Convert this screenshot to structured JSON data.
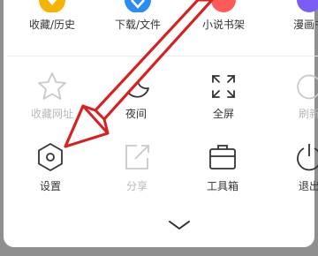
{
  "top_row": [
    {
      "label": "收藏/历史",
      "icon": "star-circle-icon",
      "color": "#f5b400"
    },
    {
      "label": "下载/文件",
      "icon": "download-circle-icon",
      "color": "#2a8cf4"
    },
    {
      "label": "小说书架",
      "icon": "book-circle-icon",
      "color": "#ff5a5a"
    },
    {
      "label": "漫画书",
      "icon": "comic-circle-icon",
      "color": "#7b5cf5"
    }
  ],
  "row1": [
    {
      "label": "收藏网址",
      "icon": "star-outline-icon",
      "enabled": false
    },
    {
      "label": "夜间",
      "icon": "moon-icon",
      "enabled": true
    },
    {
      "label": "全屏",
      "icon": "fullscreen-icon",
      "enabled": true
    },
    {
      "label": "刷新",
      "icon": "refresh-icon",
      "enabled": false
    }
  ],
  "row2": [
    {
      "label": "设置",
      "icon": "hexagon-settings-icon",
      "enabled": true
    },
    {
      "label": "分享",
      "icon": "share-icon",
      "enabled": false
    },
    {
      "label": "工具箱",
      "icon": "toolbox-icon",
      "enabled": true
    },
    {
      "label": "退出",
      "icon": "power-icon",
      "enabled": true
    }
  ],
  "annotation_color": "#d9201f"
}
